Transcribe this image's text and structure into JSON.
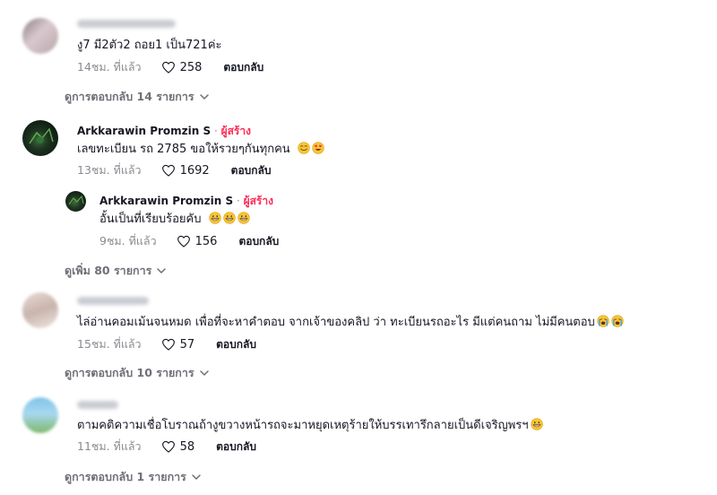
{
  "comments": [
    {
      "name": "",
      "text": "งู7 มี2ตัว2 ถอย1 เป็น721ค่ะ",
      "time": "14ชม. ที่แล้ว",
      "likes": "258",
      "reply": "ตอบกลับ",
      "more": "ดูการตอบกลับ 14 รายการ"
    },
    {
      "name": "Arkkarawin Promzin S",
      "sep": " · ",
      "badge": "ผู้สร้าง",
      "text": "เลขทะเบียน รถ 2785 ขอให้รวยๆกันทุกคน",
      "time": "13ชม. ที่แล้ว",
      "likes": "1692",
      "reply": "ตอบกลับ",
      "replies": [
        {
          "name": "Arkkarawin Promzin S",
          "sep": " · ",
          "badge": "ผู้สร้าง",
          "text": "อั้นเป็นที่เรียบร้อยคับ",
          "time": "9ชม. ที่แล้ว",
          "likes": "156",
          "reply": "ตอบกลับ"
        }
      ],
      "more": "ดูเพิ่ม 80 รายการ"
    },
    {
      "name": "",
      "text": "ไล่อ่านคอมเม้นจนหมด เพื่อที่จะหาคำตอบ จากเจ้าของคลิป ว่า ทะเบียนรถอะไร มีแต่คนถาม ไม่มีคนตอบ",
      "time": "15ชม. ที่แล้ว",
      "likes": "57",
      "reply": "ตอบกลับ",
      "more": "ดูการตอบกลับ 10 รายการ"
    },
    {
      "name": "",
      "text": "ตามคติความเชื่อโบราณถ้างูขวางหน้ารถจะมาหยุดเหตุร้ายให้บรรเทารึกลายเป็นดีเจริญพรฯ",
      "time": "11ชม. ที่แล้ว",
      "likes": "58",
      "reply": "ตอบกลับ",
      "more": "ดูการตอบกลับ 1 รายการ"
    }
  ],
  "colors": {
    "creator": "#fe2c55",
    "muted": "#8a8b91",
    "text": "#161823"
  }
}
